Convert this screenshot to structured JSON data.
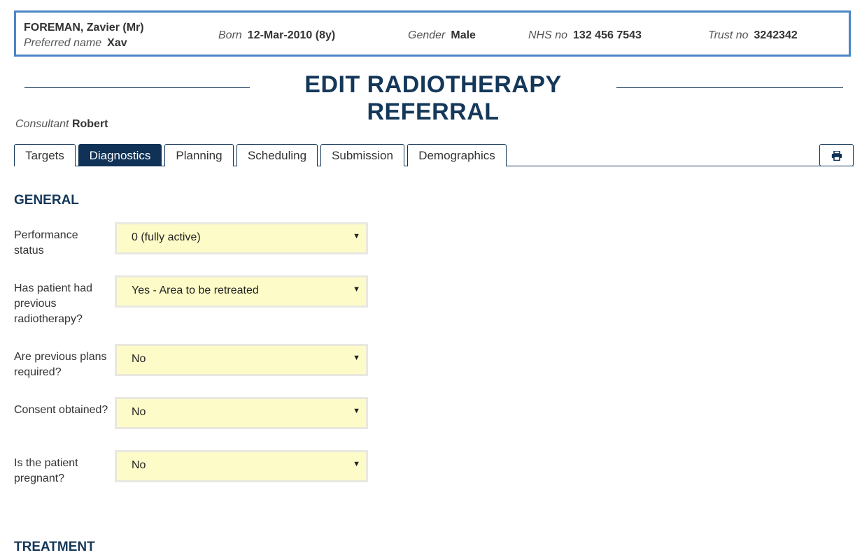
{
  "patient": {
    "name": "FOREMAN, Zavier (Mr)",
    "preferred_label": "Preferred name",
    "preferred_value": "Xav",
    "born_label": "Born",
    "born_value": "12-Mar-2010 (8y)",
    "gender_label": "Gender",
    "gender_value": "Male",
    "nhs_label": "NHS no",
    "nhs_value": "132 456 7543",
    "trust_label": "Trust no",
    "trust_value": "3242342"
  },
  "page": {
    "title": "EDIT RADIOTHERAPY REFERRAL"
  },
  "consultant": {
    "label": "Consultant",
    "value": "Robert"
  },
  "tabs": [
    {
      "label": "Targets"
    },
    {
      "label": "Diagnostics",
      "active": true
    },
    {
      "label": "Planning"
    },
    {
      "label": "Scheduling"
    },
    {
      "label": "Submission"
    },
    {
      "label": "Demographics"
    }
  ],
  "toolbar": {
    "print_icon": "print-icon"
  },
  "sections": {
    "general": "GENERAL",
    "treatment": "TREATMENT"
  },
  "form": {
    "performance_status": {
      "label": "Performance status",
      "value": "0 (fully active)"
    },
    "previous_radiotherapy": {
      "label": "Has patient had previous radiotherapy?",
      "value": "Yes - Area to be retreated"
    },
    "previous_plans": {
      "label": "Are previous plans required?",
      "value": "No"
    },
    "consent": {
      "label": "Consent obtained?",
      "value": "No"
    },
    "pregnant": {
      "label": "Is the patient pregnant?",
      "value": "No"
    }
  },
  "colors": {
    "accent": "#0f3256",
    "banner_border": "#4a86c5",
    "select_bg": "#fdfcc8"
  }
}
